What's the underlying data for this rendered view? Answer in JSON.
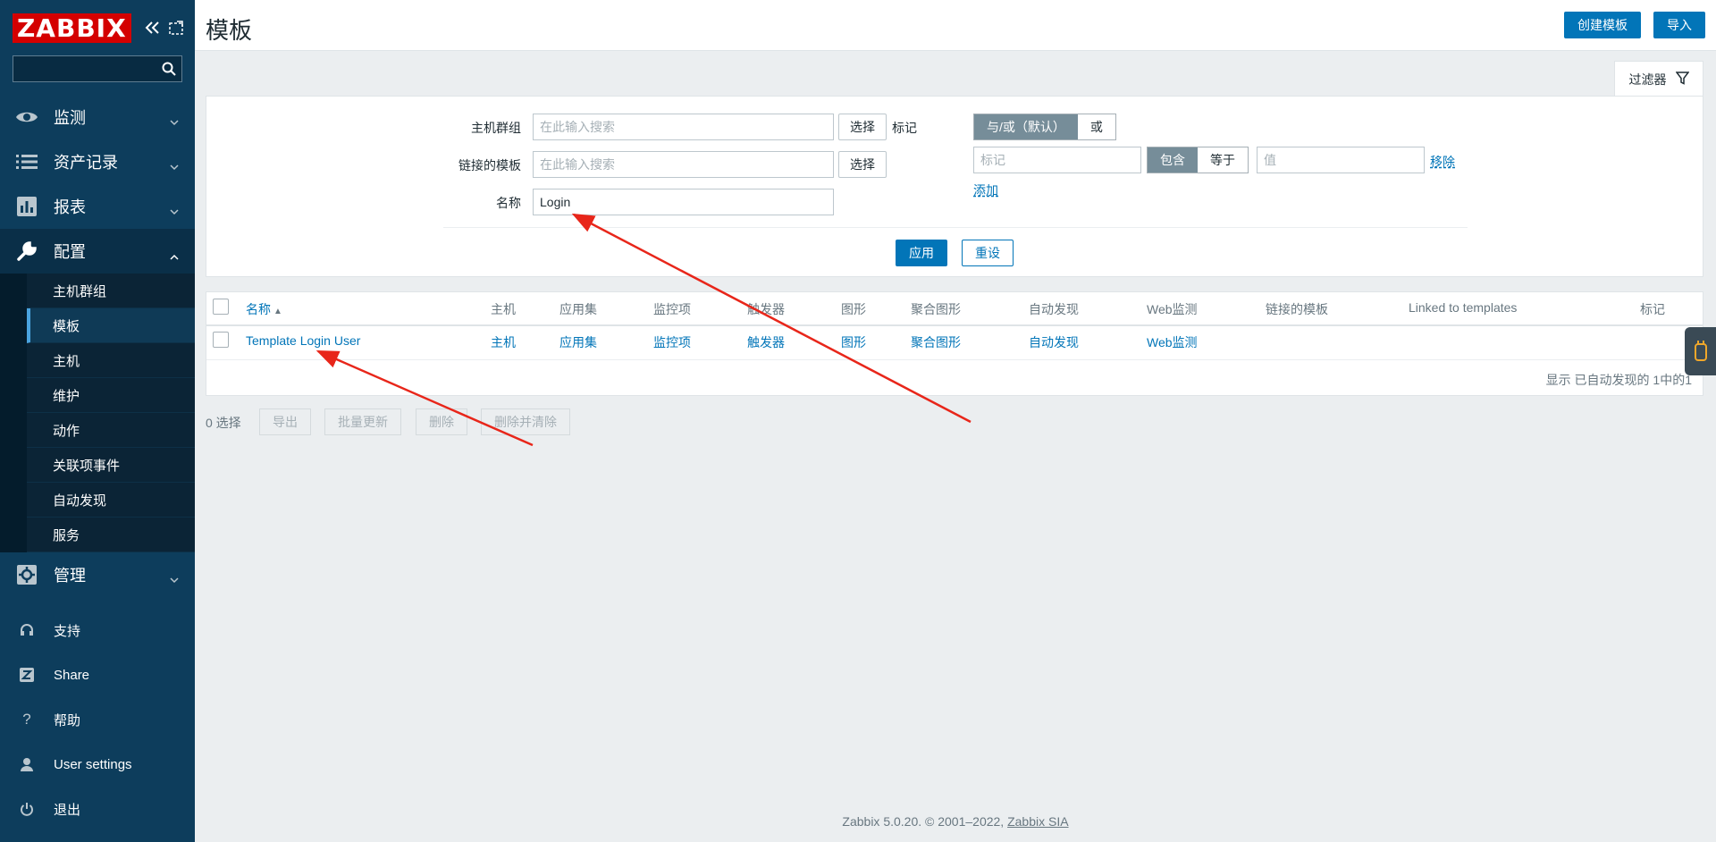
{
  "logo": "ZABBIX",
  "sidebar": {
    "search_placeholder": "",
    "menu": [
      {
        "label": "监测",
        "icon": "eye-icon"
      },
      {
        "label": "资产记录",
        "icon": "list-icon"
      },
      {
        "label": "报表",
        "icon": "bar-chart-icon"
      },
      {
        "label": "配置",
        "icon": "wrench-icon"
      }
    ],
    "config_submenu": [
      "主机群组",
      "模板",
      "主机",
      "维护",
      "动作",
      "关联项事件",
      "自动发现",
      "服务"
    ],
    "admin_label": "管理",
    "bottom": [
      "支持",
      "Share",
      "帮助",
      "User settings",
      "退出"
    ]
  },
  "header": {
    "title": "模板",
    "create_button": "创建模板",
    "import_button": "导入"
  },
  "filter": {
    "tab_label": "过滤器",
    "host_group_label": "主机群组",
    "host_group_placeholder": "在此输入搜索",
    "linked_templates_label": "链接的模板",
    "linked_templates_placeholder": "在此输入搜索",
    "select_button": "选择",
    "name_label": "名称",
    "name_value": "Login",
    "tags_label": "标记",
    "tag_and_or": "与/或（默认）",
    "tag_or": "或",
    "tag_placeholder": "标记",
    "op_contains": "包含",
    "op_equals": "等于",
    "value_placeholder": "值",
    "remove_link": "移除",
    "add_link": "添加",
    "apply_button": "应用",
    "reset_button": "重设"
  },
  "table": {
    "columns": [
      "名称",
      "主机",
      "应用集",
      "监控项",
      "触发器",
      "图形",
      "聚合图形",
      "自动发现",
      "Web监测",
      "链接的模板",
      "Linked to templates",
      "标记"
    ],
    "rows": [
      {
        "name": "Template Login User",
        "hosts": "主机",
        "applications": "应用集",
        "items": "监控项",
        "triggers": "触发器",
        "graphs": "图形",
        "screens": "聚合图形",
        "discovery": "自动发现",
        "web": "Web监测"
      }
    ],
    "footer": "显示 已自动发现的 1中的1"
  },
  "bulk": {
    "selected": "0 选择",
    "export": "导出",
    "mass_update": "批量更新",
    "delete": "删除",
    "delete_clear": "删除并清除"
  },
  "footer": {
    "text": "Zabbix 5.0.20. © 2001–2022, ",
    "link": "Zabbix SIA"
  },
  "colors": {
    "sidebar": "#0d3d5c",
    "accent": "#0275b8",
    "logo": "#d40000",
    "annotation_arrow": "#e8261a"
  }
}
